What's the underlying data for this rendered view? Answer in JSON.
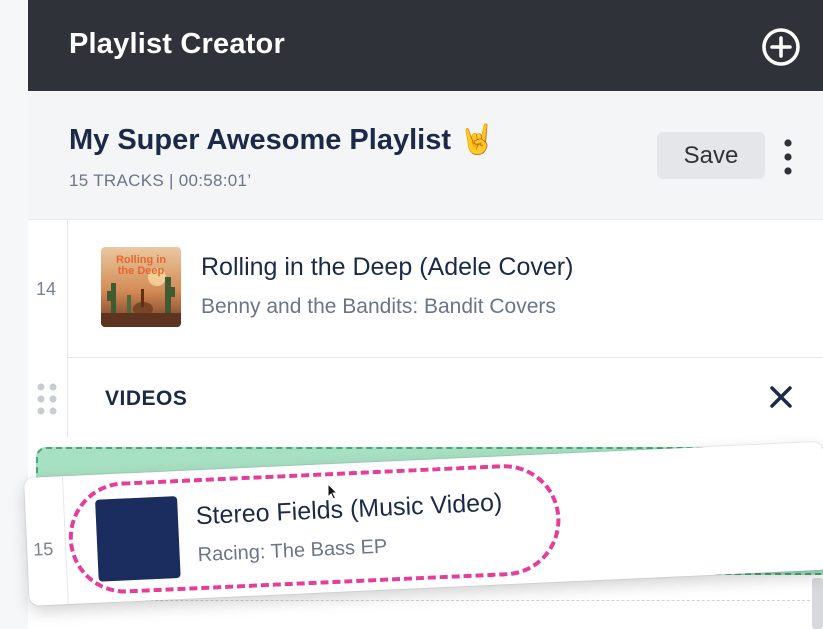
{
  "app": {
    "title": "Playlist Creator"
  },
  "playlist": {
    "name": "My Super Awesome Playlist",
    "emoji": "🤘",
    "meta": "15 TRACKS | 00:58:01’",
    "save_label": "Save"
  },
  "tracks": [
    {
      "number": "14",
      "title": "Rolling in the Deep (Adele Cover)",
      "subtitle": "Benny and the Bandits: Bandit Covers",
      "art_text": "Rolling in the Deep"
    }
  ],
  "videos_section": {
    "label": "VIDEOS"
  },
  "dragged_item": {
    "number": "15",
    "title": "Stereo Fields (Music Video)",
    "subtitle": "Racing: The Bass EP"
  },
  "colors": {
    "header_bg": "#2f3339",
    "title_text": "#1c2a48",
    "drop_zone": "#a8e0c3",
    "highlight": "#e43e9a",
    "video_art": "#1a2d5e"
  },
  "icons": [
    "plus-circle-icon",
    "more-vertical-icon",
    "close-icon",
    "drag-handle-icon",
    "cursor-icon"
  ]
}
